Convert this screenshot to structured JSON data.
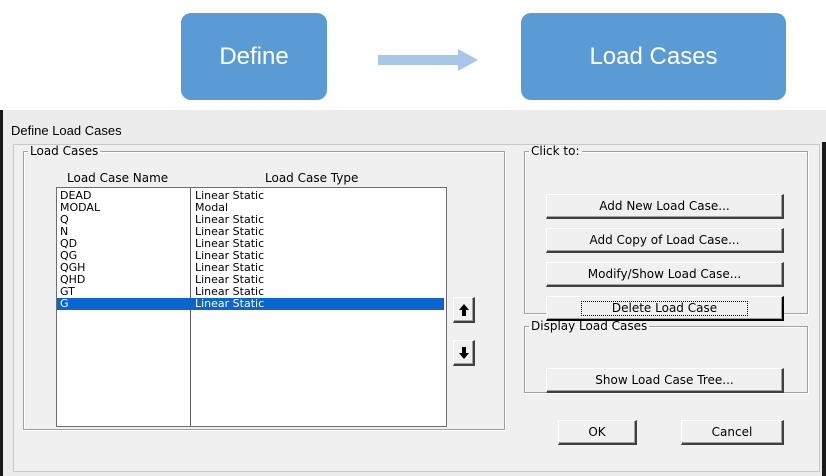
{
  "flow": {
    "step1": "Define",
    "step2": "Load Cases",
    "colors": {
      "box": "#5b9bd5",
      "arrow": "#a9c6e8",
      "text": "#ffffff"
    }
  },
  "dialog": {
    "title": "Define Load Cases",
    "load_cases_group": {
      "legend": "Load Cases",
      "columns": [
        "Load Case Name",
        "Load Case Type"
      ],
      "rows": [
        {
          "name": "DEAD",
          "type": "Linear Static"
        },
        {
          "name": "MODAL",
          "type": "Modal"
        },
        {
          "name": "Q",
          "type": "Linear Static"
        },
        {
          "name": "N",
          "type": "Linear Static"
        },
        {
          "name": "QD",
          "type": "Linear Static"
        },
        {
          "name": "QG",
          "type": "Linear Static"
        },
        {
          "name": "QGH",
          "type": "Linear Static"
        },
        {
          "name": "QHD",
          "type": "Linear Static"
        },
        {
          "name": "GT",
          "type": "Linear Static"
        },
        {
          "name": "G",
          "type": "Linear Static"
        }
      ],
      "selected_row": "G",
      "selection_color": "#0a64d2",
      "move_up_icon": "arrow-up-icon",
      "move_down_icon": "arrow-down-icon"
    },
    "click_to_group": {
      "legend": "Click to:",
      "buttons": {
        "add_new": "Add New Load Case...",
        "add_copy": "Add Copy of Load Case...",
        "modify_show": "Modify/Show Load Case...",
        "delete": "Delete Load Case"
      }
    },
    "display_group": {
      "legend": "Display Load Cases",
      "show_tree": "Show Load Case Tree..."
    },
    "ok": "OK",
    "cancel": "Cancel"
  }
}
